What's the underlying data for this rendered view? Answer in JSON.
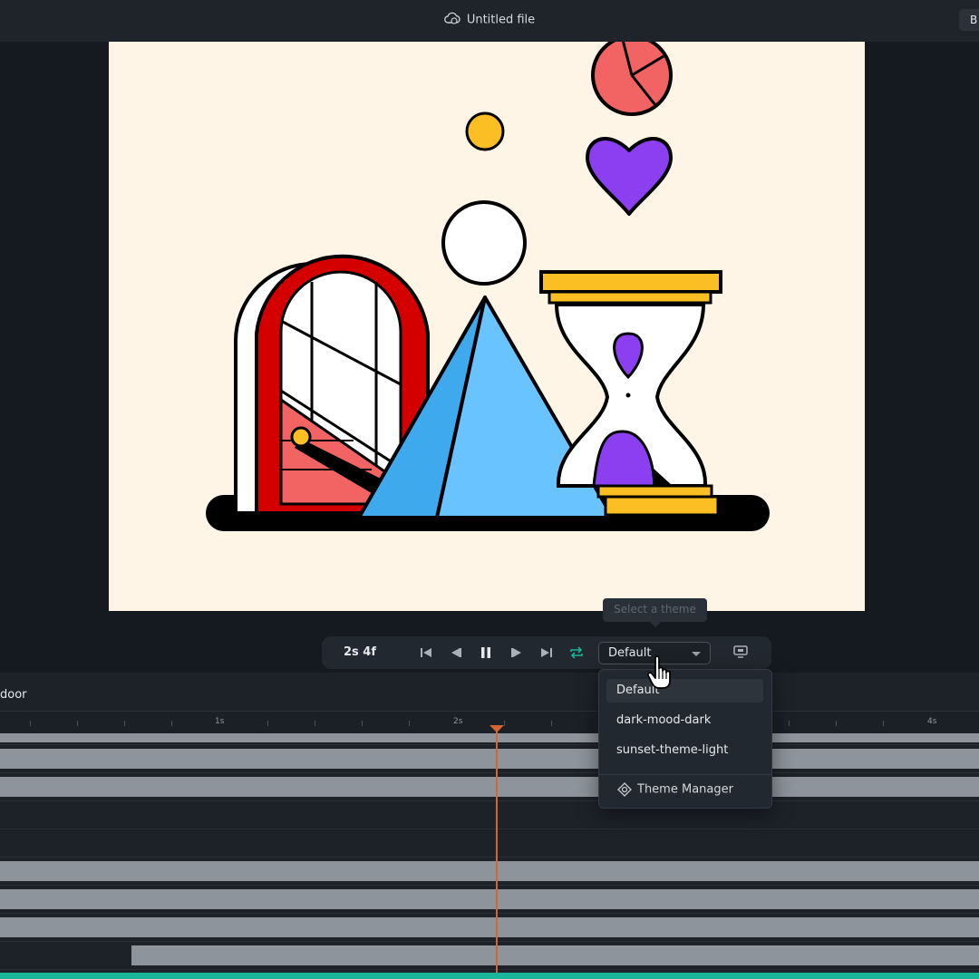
{
  "window": {
    "title": "Untitled file",
    "top_right_button": "B"
  },
  "player": {
    "time": "2s 4f",
    "theme_label": "Default",
    "tooltip": "Select a theme"
  },
  "theme_menu": {
    "options": [
      "Default",
      "dark-mood-dark",
      "sunset-theme-light"
    ],
    "selected": "Default",
    "manager_label": "Theme Manager"
  },
  "timeline": {
    "layer_name": "door",
    "ruler_labels": [
      "1s",
      "2s",
      "4s"
    ]
  },
  "colors": {
    "canvas_bg": "#fef5e7",
    "accent_playhead": "#d8642f",
    "loop_icon": "#1bb59a",
    "door_red": "#d40000",
    "pyramid_blue": "#69c3ff",
    "hourglass_gold": "#fbbf24",
    "heart_purple": "#8c3ff0",
    "circle_coral": "#f26363"
  }
}
